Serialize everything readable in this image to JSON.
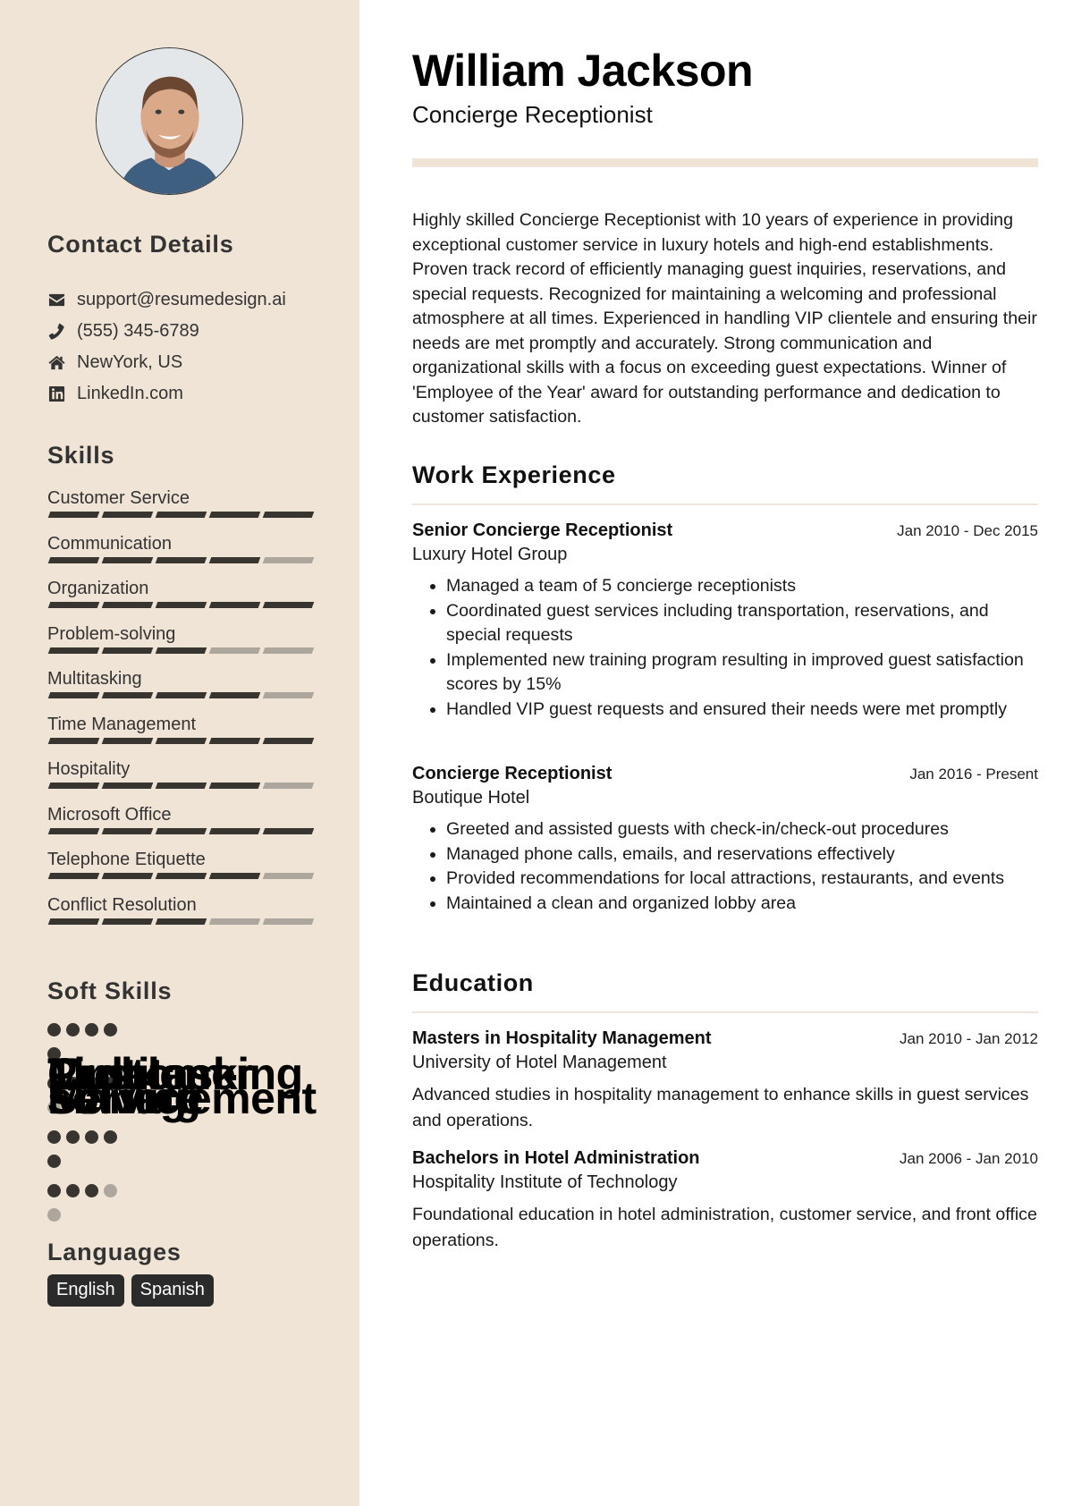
{
  "profile": {
    "name": "William Jackson",
    "title": "Concierge Receptionist",
    "photo_alt": "Profile photo of smiling man"
  },
  "sidebar": {
    "contact_heading": "Contact Details",
    "contact": [
      {
        "icon": "envelope-icon",
        "text": "support@resumedesign.ai"
      },
      {
        "icon": "phone-icon",
        "text": "(555) 345-6789"
      },
      {
        "icon": "home-icon",
        "text": "NewYork, US"
      },
      {
        "icon": "linkedin-icon",
        "text": "LinkedIn.com"
      }
    ],
    "skills_heading": "Skills",
    "skills": [
      {
        "name": "Customer Service",
        "level": 5,
        "max": 5
      },
      {
        "name": "Communication",
        "level": 4,
        "max": 5
      },
      {
        "name": "Organization",
        "level": 5,
        "max": 5
      },
      {
        "name": "Problem-solving",
        "level": 3,
        "max": 5
      },
      {
        "name": "Multitasking",
        "level": 4,
        "max": 5
      },
      {
        "name": "Time Management",
        "level": 5,
        "max": 5
      },
      {
        "name": "Hospitality",
        "level": 4,
        "max": 5
      },
      {
        "name": "Microsoft Office",
        "level": 5,
        "max": 5
      },
      {
        "name": "Telephone Etiquette",
        "level": 4,
        "max": 5
      },
      {
        "name": "Conflict Resolution",
        "level": 3,
        "max": 5
      }
    ],
    "soft_skills_heading": "Soft Skills",
    "soft_skills": [
      {
        "name": "Customer Service",
        "level": 5,
        "max": 5
      },
      {
        "name": "Problem-solving",
        "level": 4,
        "max": 5
      },
      {
        "name": "Time Management",
        "level": 5,
        "max": 5
      },
      {
        "name": "Multitasking",
        "level": 3,
        "max": 5
      }
    ],
    "languages_heading": "Languages",
    "languages": [
      "English",
      "Spanish"
    ]
  },
  "summary": "Highly skilled Concierge Receptionist with 10 years of experience in providing exceptional customer service in luxury hotels and high-end establishments. Proven track record of efficiently managing guest inquiries, reservations, and special requests. Recognized for maintaining a welcoming and professional atmosphere at all times. Experienced in handling VIP clientele and ensuring their needs are met promptly and accurately. Strong communication and organizational skills with a focus on exceeding guest expectations. Winner of 'Employee of the Year' award for outstanding performance and dedication to customer satisfaction.",
  "work": {
    "heading": "Work Experience",
    "jobs": [
      {
        "title": "Senior Concierge Receptionist",
        "company": "Luxury Hotel Group",
        "dates": "Jan 2010 - Dec 2015",
        "bullets": [
          "Managed a team of 5 concierge receptionists",
          "Coordinated guest services including transportation, reservations, and special requests",
          "Implemented new training program resulting in improved guest satisfaction scores by 15%",
          "Handled VIP guest requests and ensured their needs were met promptly"
        ]
      },
      {
        "title": "Concierge Receptionist",
        "company": "Boutique Hotel",
        "dates": "Jan 2016 - Present",
        "bullets": [
          "Greeted and assisted guests with check-in/check-out procedures",
          "Managed phone calls, emails, and reservations effectively",
          "Provided recommendations for local attractions, restaurants, and events",
          "Maintained a clean and organized lobby area"
        ]
      }
    ]
  },
  "education": {
    "heading": "Education",
    "items": [
      {
        "degree": "Masters in Hospitality Management",
        "school": "University of Hotel Management",
        "dates": "Jan 2010 - Jan 2012",
        "description": "Advanced studies in hospitality management to enhance skills in guest services and operations."
      },
      {
        "degree": "Bachelors in Hotel Administration",
        "school": "Hospitality Institute of Technology",
        "dates": "Jan 2006 - Jan 2010",
        "description": "Foundational education in hotel administration, customer service, and front office operations."
      }
    ]
  },
  "colors": {
    "sidebar_bg": "#f0e4d6",
    "accent_dark": "#383530",
    "accent_light": "#ada69c",
    "chip_bg": "#2b2b2b"
  }
}
